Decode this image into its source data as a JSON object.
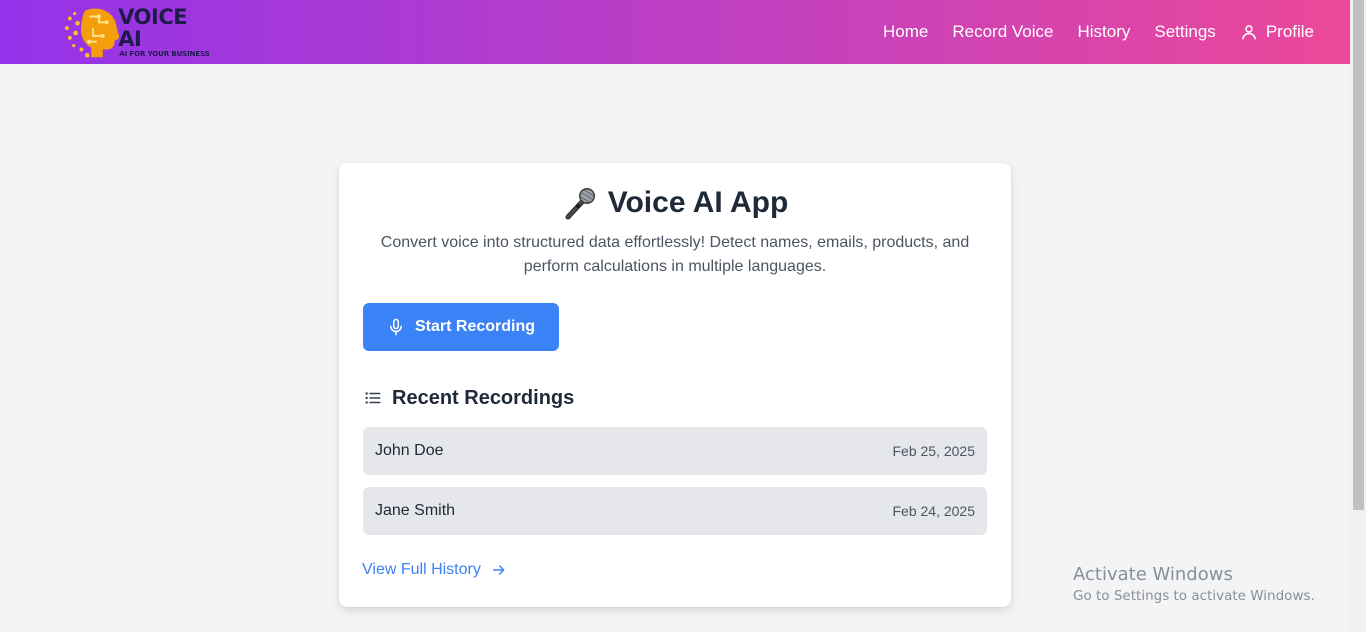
{
  "brand": {
    "title": "VOICE AI",
    "tagline": "AI FOR YOUR BUSINESS",
    "logo_icon": "robot-head-icon",
    "colors": {
      "gradient_start": "#9333ea",
      "gradient_end": "#ec4899",
      "logo_accent": "#fbbf24"
    }
  },
  "nav": {
    "items": [
      {
        "label": "Home"
      },
      {
        "label": "Record Voice"
      },
      {
        "label": "History"
      },
      {
        "label": "Settings"
      },
      {
        "label": "Profile",
        "icon": "user-icon"
      }
    ]
  },
  "main": {
    "title": "Voice AI App",
    "title_icon": "microphone-emoji-icon",
    "description": "Convert voice into structured data effortlessly! Detect names, emails, products, and perform calculations in multiple languages.",
    "record_button": {
      "label": "Start Recording",
      "icon": "microphone-icon",
      "color": "#3b82f6"
    },
    "recent": {
      "heading": "Recent Recordings",
      "icon": "list-icon",
      "items": [
        {
          "name": "John Doe",
          "date": "Feb 25, 2025"
        },
        {
          "name": "Jane Smith",
          "date": "Feb 24, 2025"
        }
      ]
    },
    "history_link": {
      "label": "View Full History",
      "icon": "arrow-right-icon"
    }
  },
  "watermark": {
    "title": "Activate Windows",
    "subtitle": "Go to Settings to activate Windows."
  }
}
